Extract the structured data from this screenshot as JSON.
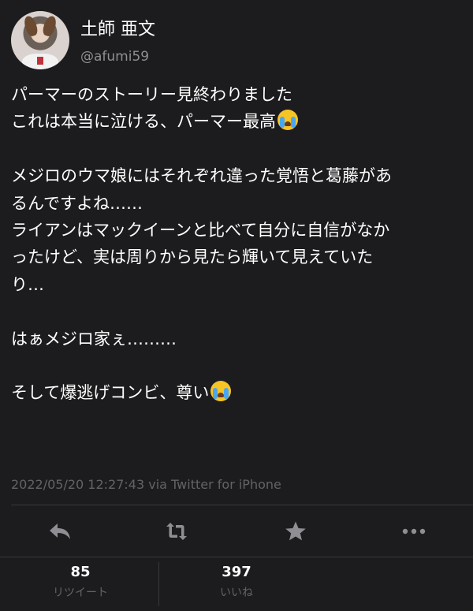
{
  "user": {
    "display_name": "土師 亜文",
    "handle": "@afumi59",
    "avatar_icon": "profile-photo-avatar"
  },
  "tweet": {
    "lines": [
      {
        "text": "パーマーのストーリー見終わりました",
        "emoji": ""
      },
      {
        "text": "これは本当に泣ける、パーマー最高",
        "emoji": "loudly-crying-face"
      },
      {
        "text": "",
        "emoji": ""
      },
      {
        "text": "メジロのウマ娘にはそれぞれ違った覚悟と葛藤があ",
        "emoji": ""
      },
      {
        "text": "るんですよね……",
        "emoji": ""
      },
      {
        "text": "ライアンはマックイーンと比べて自分に自信がなか",
        "emoji": ""
      },
      {
        "text": "ったけど、実は周りから見たら輝いて見えていた",
        "emoji": ""
      },
      {
        "text": "り…",
        "emoji": ""
      },
      {
        "text": "",
        "emoji": ""
      },
      {
        "text": "はぁメジロ家ぇ………",
        "emoji": ""
      },
      {
        "text": "",
        "emoji": ""
      },
      {
        "text": "そして爆逃げコンビ、尊い",
        "emoji": "loudly-crying-face"
      }
    ],
    "timestamp": "2022/05/20 12:27:43 via Twitter for iPhone"
  },
  "actions": [
    {
      "name": "reply-icon"
    },
    {
      "name": "retweet-icon"
    },
    {
      "name": "like-star-icon"
    },
    {
      "name": "more-options-icon"
    }
  ],
  "stats": {
    "retweets": {
      "count": "85",
      "label": "リツイート"
    },
    "likes": {
      "count": "397",
      "label": "いいね"
    }
  },
  "colors": {
    "background": "#1c1c1e",
    "text": "#ffffff",
    "secondary_text": "#8e8e93",
    "muted_text": "#636366",
    "icon": "#8e8e93",
    "divider": "#38383a"
  }
}
